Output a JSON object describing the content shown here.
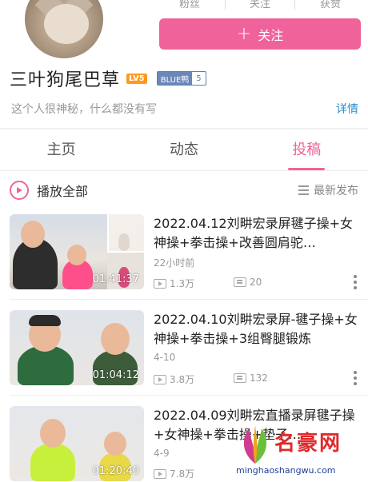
{
  "stats": {
    "fans_label": "粉丝",
    "follow_label": "关注",
    "likes_label": "获赞"
  },
  "follow_button": {
    "icon": "plus-icon",
    "label": "关注"
  },
  "profile": {
    "name": "三叶狗尾巴草",
    "level_badge": "LV5",
    "medal_name": "BLUE鸭",
    "medal_level": "5",
    "bio": "这个人很神秘，什么都没有写",
    "detail_link": "详情"
  },
  "tabs": [
    {
      "label": "主页",
      "active": false
    },
    {
      "label": "动态",
      "active": false
    },
    {
      "label": "投稿",
      "active": true
    }
  ],
  "play_row": {
    "play_all": "播放全部",
    "sort_label": "最新发布"
  },
  "videos": [
    {
      "title": "2022.04.12刘畊宏录屏毽子操+女神操+拳击操+改善圆肩驼…",
      "duration": "01:41:37",
      "time": "22小时前",
      "plays": "1.3万",
      "danmaku": "20"
    },
    {
      "title": "2022.04.10刘畊宏录屏-毽子操+女神操+拳击操+3组臀腿锻炼",
      "duration": "01:04:12",
      "time": "4-10",
      "plays": "3.8万",
      "danmaku": "132"
    },
    {
      "title": "2022.04.09刘畊宏直播录屏毽子操+女神操+拳击操+垫子…",
      "duration": "01:20:40",
      "time": "4-9",
      "plays": "7.8万",
      "danmaku": ""
    }
  ],
  "watermark": {
    "brand": "名豪网",
    "url": "minghaoshangwu.com"
  },
  "colors": {
    "accent": "#f0639a",
    "link": "#2a8cc9",
    "lv": "#ff9a1f"
  }
}
